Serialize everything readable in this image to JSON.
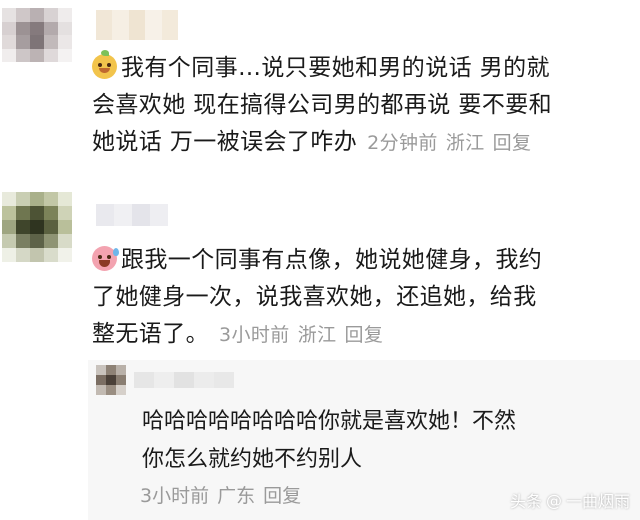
{
  "comments": [
    {
      "text": "我有个同事…说只要她和男的说话 男的就会喜欢她 现在搞得公司男的都再说 要不要和她说话 万一被误会了咋办",
      "lines": [
        "我有个同事…说只要她和男的说话 男的就",
        "会喜欢她 现在搞得公司男的都再说 要不要和",
        "她说话 万一被误会了咋办"
      ],
      "time": "2分钟前",
      "location": "浙江",
      "reply_label": "回复",
      "emoji_icon": "doge-emoji-icon"
    },
    {
      "text": "跟我一个同事有点像，她说她健身，我约了她健身一次，说我喜欢她，还追她，给我整无语了。",
      "lines": [
        "跟我一个同事有点像，她说她健身，我约",
        "了她健身一次，说我喜欢她，还追她，给我",
        "整无语了。"
      ],
      "time": "3小时前",
      "location": "浙江",
      "reply_label": "回复",
      "emoji_icon": "sweat-laugh-emoji-icon"
    }
  ],
  "reply": {
    "text": "哈哈哈哈哈哈哈哈你就是喜欢她！不然你怎么就约她不约别人",
    "lines": [
      "哈哈哈哈哈哈哈哈你就是喜欢她！不然",
      "你怎么就约她不约别人"
    ],
    "time": "3小时前",
    "location": "广东",
    "reply_label": "回复"
  },
  "watermark": {
    "source": "头条",
    "at": "@",
    "author": "一曲烟雨"
  }
}
